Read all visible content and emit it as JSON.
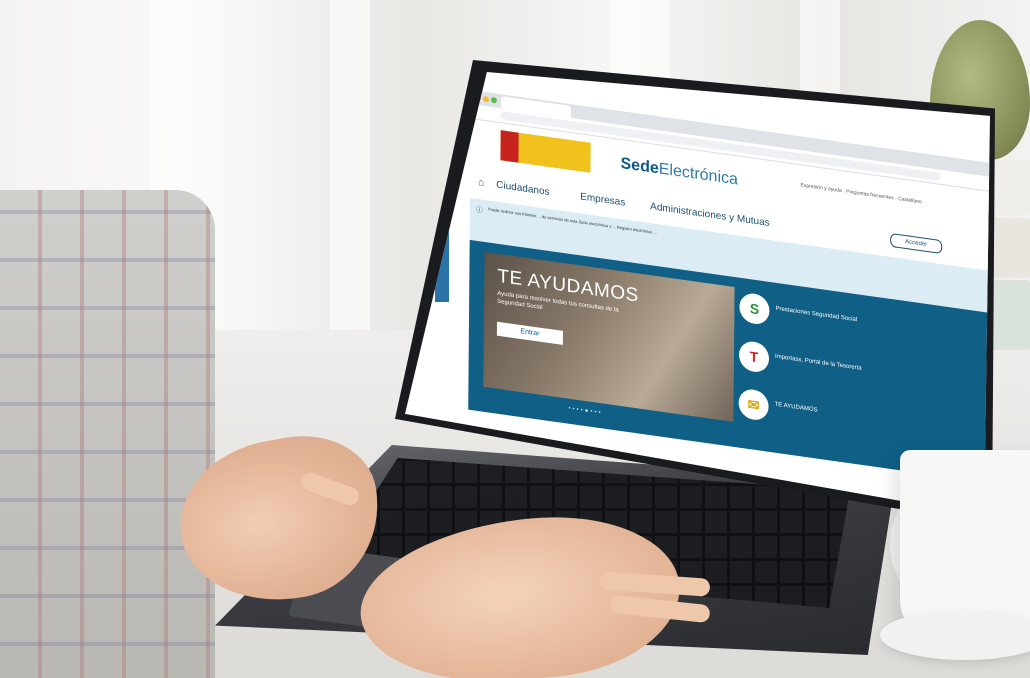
{
  "browser": {
    "logo_text_bold": "Sede",
    "logo_text_light": "Electrónica",
    "header_links": "Expresión y ayuda · Preguntas frecuentes · Castellano"
  },
  "nav": {
    "items": [
      "Ciudadanos",
      "Empresas",
      "Administraciones y Mutuas"
    ],
    "login_label": "Acceder"
  },
  "notice": {
    "text": "Puede realizar sus trámites ... de servicios de esta Sede electrónica y ... Registro electrónico ..."
  },
  "hero": {
    "title": "TE AYUDAMOS",
    "subtitle": "Ayuda para resolver todas tus consultas de la Seguridad Social",
    "button_label": "Entrar",
    "slider_dots": "••••●•••"
  },
  "side_items": [
    {
      "label": "Prestaciones Seguridad Social",
      "icon": "prestaciones-icon",
      "color": "#2f8f3a"
    },
    {
      "label": "Importass, Portal de la Tesorería",
      "icon": "tesoreria-icon",
      "color": "#d2232a"
    },
    {
      "label": "TE AYUDAMOS",
      "icon": "te-ayudamos-icon",
      "color": "#e0a400"
    }
  ],
  "colors": {
    "brand_blue": "#0f5f86",
    "notice_bg": "#dcecf4",
    "flag_yellow": "#f1c21b",
    "flag_red": "#c8241e"
  }
}
